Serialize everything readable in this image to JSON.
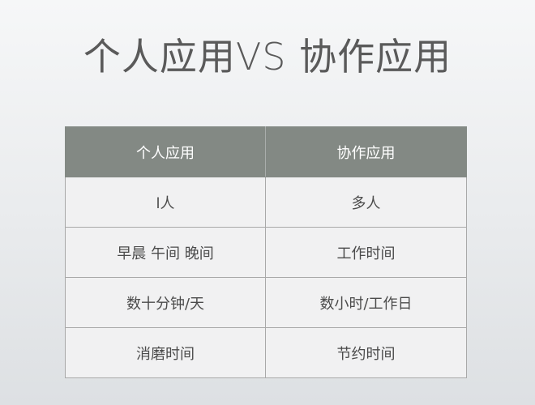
{
  "slide": {
    "title": "个人应用VS 协作应用"
  },
  "table": {
    "headers": [
      "个人应用",
      "协作应用"
    ],
    "rows": [
      [
        "l人",
        "多人"
      ],
      [
        "早晨 午间 晚间",
        "工作时间"
      ],
      [
        "数十分钟/天",
        "数小时/工作日"
      ],
      [
        "消磨时间",
        "节约时间"
      ]
    ]
  }
}
